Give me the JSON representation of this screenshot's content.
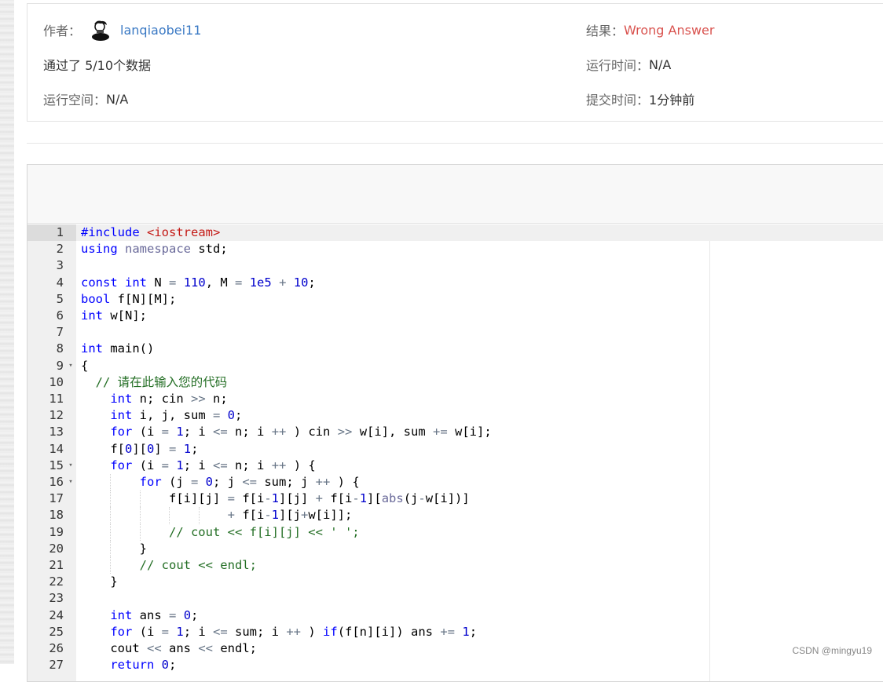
{
  "submission": {
    "author_label": "作者：",
    "author_name": "lanqiaobei11",
    "result_label": "结果：",
    "result_value": "Wrong Answer",
    "passed_text": "通过了 5/10个数据",
    "runtime_label": "运行时间：",
    "runtime_value": "N/A",
    "memory_label": "运行空间：",
    "memory_value": "N/A",
    "submit_time_label": "提交时间：",
    "submit_time_value": "1分钟前"
  },
  "colors": {
    "link": "#3a79c4",
    "wrong_answer": "#d9534f",
    "keyword": "#0000ff",
    "comment": "#236e24",
    "number": "#0000cd",
    "string": "#c41a16"
  },
  "code": {
    "active_line": 1,
    "lines": [
      {
        "n": "1",
        "text": "#include <iostream>"
      },
      {
        "n": "2",
        "text": "using namespace std;"
      },
      {
        "n": "3",
        "text": ""
      },
      {
        "n": "4",
        "text": "const int N = 110, M = 1e5 + 10;"
      },
      {
        "n": "5",
        "text": "bool f[N][M];"
      },
      {
        "n": "6",
        "text": "int w[N];"
      },
      {
        "n": "7",
        "text": ""
      },
      {
        "n": "8",
        "text": "int main()"
      },
      {
        "n": "9",
        "text": "{",
        "fold": true
      },
      {
        "n": "10",
        "text": "  // 请在此输入您的代码"
      },
      {
        "n": "11",
        "text": "    int n; cin >> n;"
      },
      {
        "n": "12",
        "text": "    int i, j, sum = 0;"
      },
      {
        "n": "13",
        "text": "    for (i = 1; i <= n; i ++ ) cin >> w[i], sum += w[i];"
      },
      {
        "n": "14",
        "text": "    f[0][0] = 1;"
      },
      {
        "n": "15",
        "text": "    for (i = 1; i <= n; i ++ ) {",
        "fold": true
      },
      {
        "n": "16",
        "text": "        for (j = 0; j <= sum; j ++ ) {",
        "fold": true
      },
      {
        "n": "17",
        "text": "            f[i][j] = f[i-1][j] + f[i-1][abs(j-w[i])]"
      },
      {
        "n": "18",
        "text": "                    + f[i-1][j+w[i]];"
      },
      {
        "n": "19",
        "text": "            // cout << f[i][j] << ' ';"
      },
      {
        "n": "20",
        "text": "        }"
      },
      {
        "n": "21",
        "text": "        // cout << endl;"
      },
      {
        "n": "22",
        "text": "    }"
      },
      {
        "n": "23",
        "text": ""
      },
      {
        "n": "24",
        "text": "    int ans = 0;"
      },
      {
        "n": "25",
        "text": "    for (i = 1; i <= sum; i ++ ) if(f[n][i]) ans += 1;"
      },
      {
        "n": "26",
        "text": "    cout << ans << endl;"
      },
      {
        "n": "27",
        "text": "    return 0;"
      }
    ]
  },
  "watermark": "CSDN @mingyu19"
}
